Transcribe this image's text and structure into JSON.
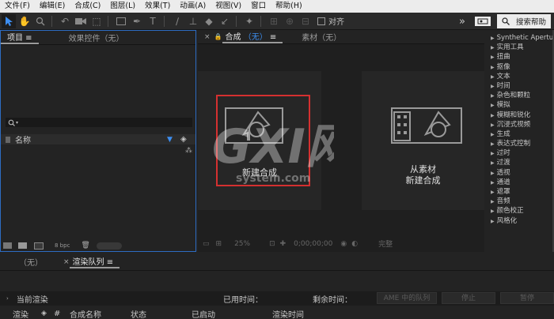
{
  "menubar": {
    "items": [
      "文件(F)",
      "编辑(E)",
      "合成(C)",
      "图层(L)",
      "效果(T)",
      "动画(A)",
      "视图(V)",
      "窗口",
      "帮助(H)"
    ]
  },
  "toolbar": {
    "snap_label": "对齐",
    "search_help_label": "搜索帮助",
    "expand_label": "»"
  },
  "project_panel": {
    "tab_project": "项目",
    "tab_effects_controls": "效果控件（无）",
    "col_name": "名称",
    "bpc_label": "8 bpc"
  },
  "composition_panel": {
    "tab_composition": "合成",
    "tab_composition_value": "（无）",
    "tab_footage": "素材（无）",
    "new_comp_label": "新建合成",
    "from_footage_line1": "从素材",
    "from_footage_line2": "新建合成",
    "footer": {
      "zoom": "25%",
      "timecode": "0;00;00;00",
      "resolution": "完整"
    }
  },
  "effects_panel": {
    "items": [
      "Synthetic Aperture",
      "实用工具",
      "扭曲",
      "抠像",
      "文本",
      "时间",
      "杂色和颗粒",
      "模拟",
      "模糊和锐化",
      "沉浸式视频",
      "生成",
      "表达式控制",
      "过时",
      "过渡",
      "透视",
      "通道",
      "遮罩",
      "音频",
      "颜色校正",
      "风格化"
    ]
  },
  "render_queue": {
    "tab_none": "（无）",
    "tab_render_queue": "渲染队列",
    "current_render_label": "当前渲染",
    "elapsed_label": "已用时间：",
    "remaining_label": "剩余时间：",
    "ame_button": "AME 中的队列",
    "stop_button": "停止",
    "pause_button": "暂停",
    "columns": [
      "渲染",
      "#",
      "合成名称",
      "状态",
      "已启动",
      "渲染时间"
    ]
  },
  "watermark": {
    "logo_text": "GXI网",
    "sub_text": "system.com"
  },
  "colors": {
    "accent": "#2d6cc3",
    "highlight_box": "#d43030",
    "background": "#232323"
  }
}
